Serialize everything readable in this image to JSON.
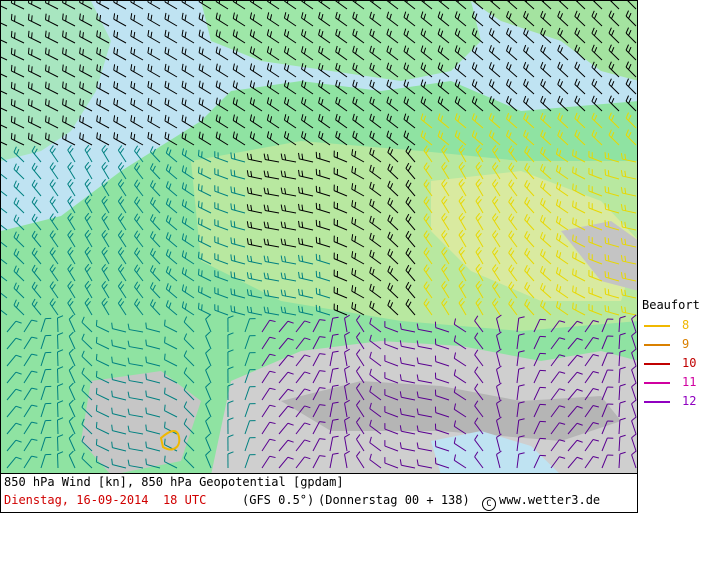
{
  "map": {
    "title": "850 hPa Wind [kn], 850 hPa Geopotential [gpdam]",
    "run_info": "Dienstag, 16-09-2014  18 UTC",
    "model": "(GFS 0.5°)",
    "forecast_info": "(Donnerstag 00 + 138)",
    "credit": "www.wetter3.de",
    "copyright_icon": "copyright-circle-icon",
    "colors": {
      "sea": "#bfe3f2",
      "land_low": "#8fe3a2",
      "land_high": "#b8dd94",
      "mountain": "#c8c8c8",
      "barb_default": "#000000",
      "barb_teal": "#008080",
      "barb_yellow": "#e8d800",
      "barb_purple": "#5a0090",
      "run_info_text": "#d00000"
    }
  },
  "legend": {
    "title": "Beaufort",
    "items": [
      {
        "label": "8",
        "color": "#f0b800"
      },
      {
        "label": "9",
        "color": "#d98000"
      },
      {
        "label": "10",
        "color": "#c00000"
      },
      {
        "label": "11",
        "color": "#d000a0"
      },
      {
        "label": "12",
        "color": "#9000c0"
      }
    ]
  }
}
